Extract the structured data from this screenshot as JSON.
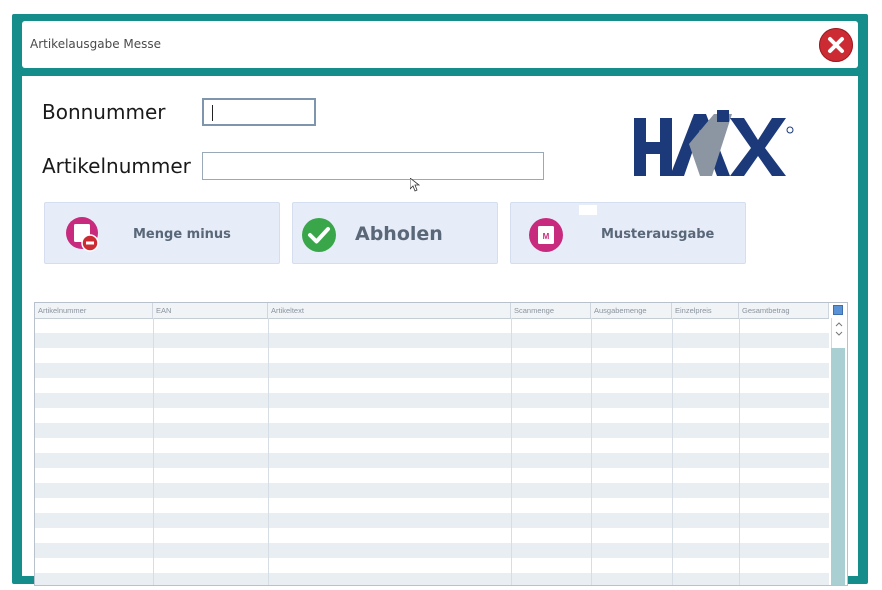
{
  "window": {
    "title": "Artikelausgabe Messe",
    "close_icon": "close-icon"
  },
  "form": {
    "bonnummer_label": "Bonnummer",
    "bonnummer_value": "",
    "artikelnummer_label": "Artikelnummer",
    "artikelnummer_value": ""
  },
  "logo": {
    "alt": "HAIX"
  },
  "buttons": {
    "menge_minus": "Menge minus",
    "abholen": "Abholen",
    "musterausgabe": "Musterausgabe"
  },
  "colors": {
    "frame": "#148d8b",
    "close": "#cc2b33",
    "button_bg": "#e6edf8",
    "green": "#3aa64a",
    "pink": "#c82a7e",
    "logo_navy": "#1c3a7a"
  },
  "grid": {
    "columns": [
      "Artikelnummer",
      "EAN",
      "Artikeltext",
      "Scanmenge",
      "Ausgabemenge",
      "Einzelpreis",
      "Gesamtbetrag"
    ],
    "rows": []
  }
}
